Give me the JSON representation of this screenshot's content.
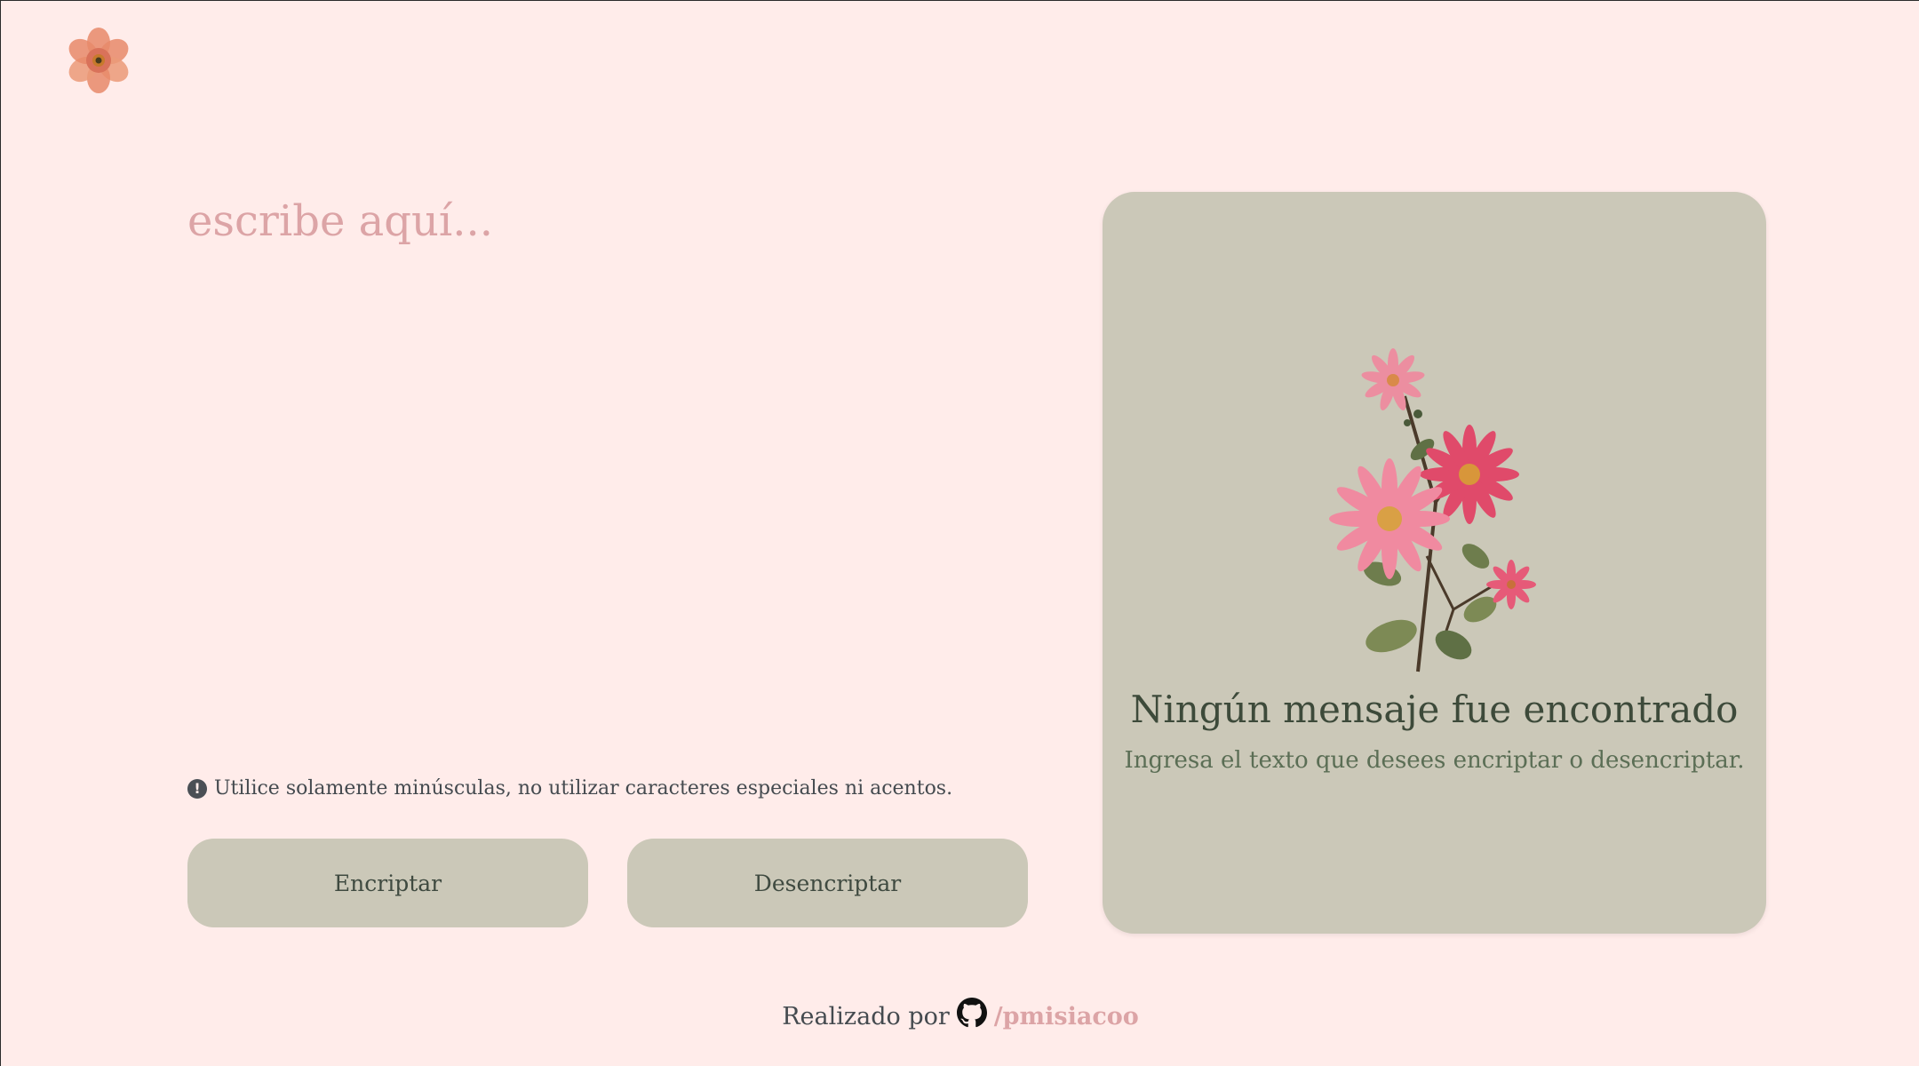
{
  "app": {
    "logo_icon": "flower-logo-icon"
  },
  "editor": {
    "placeholder": "escribe aquí...",
    "value": ""
  },
  "notice": {
    "icon": "exclamation-circle-icon",
    "text": "Utilice solamente minúsculas, no utilizar caracteres especiales ni acentos."
  },
  "actions": {
    "encrypt_label": "Encriptar",
    "decrypt_label": "Desencriptar"
  },
  "result": {
    "illustration": "flower-bouquet-illustration",
    "title": "Ningún mensaje fue encontrado",
    "subtitle": "Ingresa el texto que desees encriptar o desencriptar."
  },
  "footer": {
    "prefix": "Realizado por",
    "icon": "github-icon",
    "link_text": "/pmisiacoo"
  },
  "colors": {
    "background": "#ffecea",
    "panel": "#cbc8b8",
    "accent_pink": "#dca4a6",
    "title_green": "#3d4a3a",
    "subtitle_green": "#5b6e55"
  }
}
